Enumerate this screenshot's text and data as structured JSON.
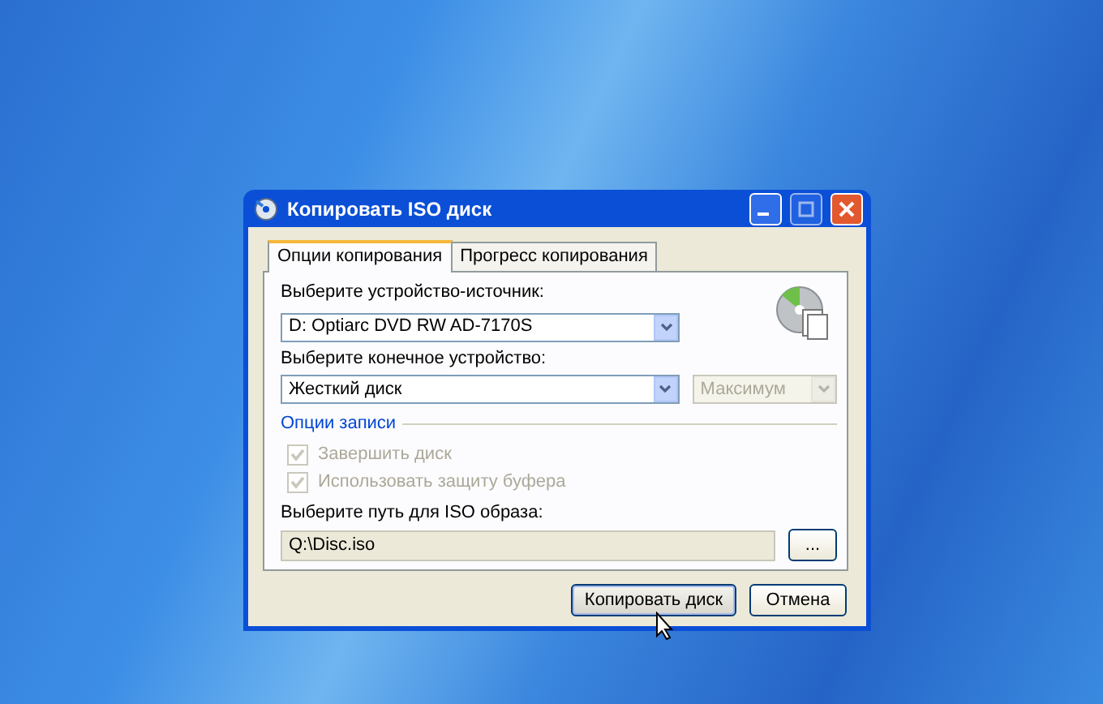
{
  "window": {
    "title": "Копировать ISO диск"
  },
  "tabs": [
    {
      "label": "Опции копирования",
      "selected": true
    },
    {
      "label": "Прогресс копирования",
      "selected": false
    }
  ],
  "source": {
    "label": "Выберите устройство-источник:",
    "value": "D: Optiarc DVD RW AD-7170S"
  },
  "target": {
    "label": "Выберите конечное устройство:",
    "value": "Жесткий диск",
    "speed": {
      "value": "Максимум",
      "disabled": true
    }
  },
  "write_options": {
    "title": "Опции записи",
    "options": [
      {
        "label": "Завершить диск",
        "checked": true,
        "disabled": true
      },
      {
        "label": "Использовать защиту буфера",
        "checked": true,
        "disabled": true
      }
    ]
  },
  "iso_path": {
    "label": "Выберите путь для ISO образа:",
    "value": "Q:\\Disc.iso",
    "browse": "..."
  },
  "buttons": [
    {
      "label": "Копировать диск",
      "kind": "default"
    },
    {
      "label": "Отмена",
      "kind": "normal"
    }
  ]
}
